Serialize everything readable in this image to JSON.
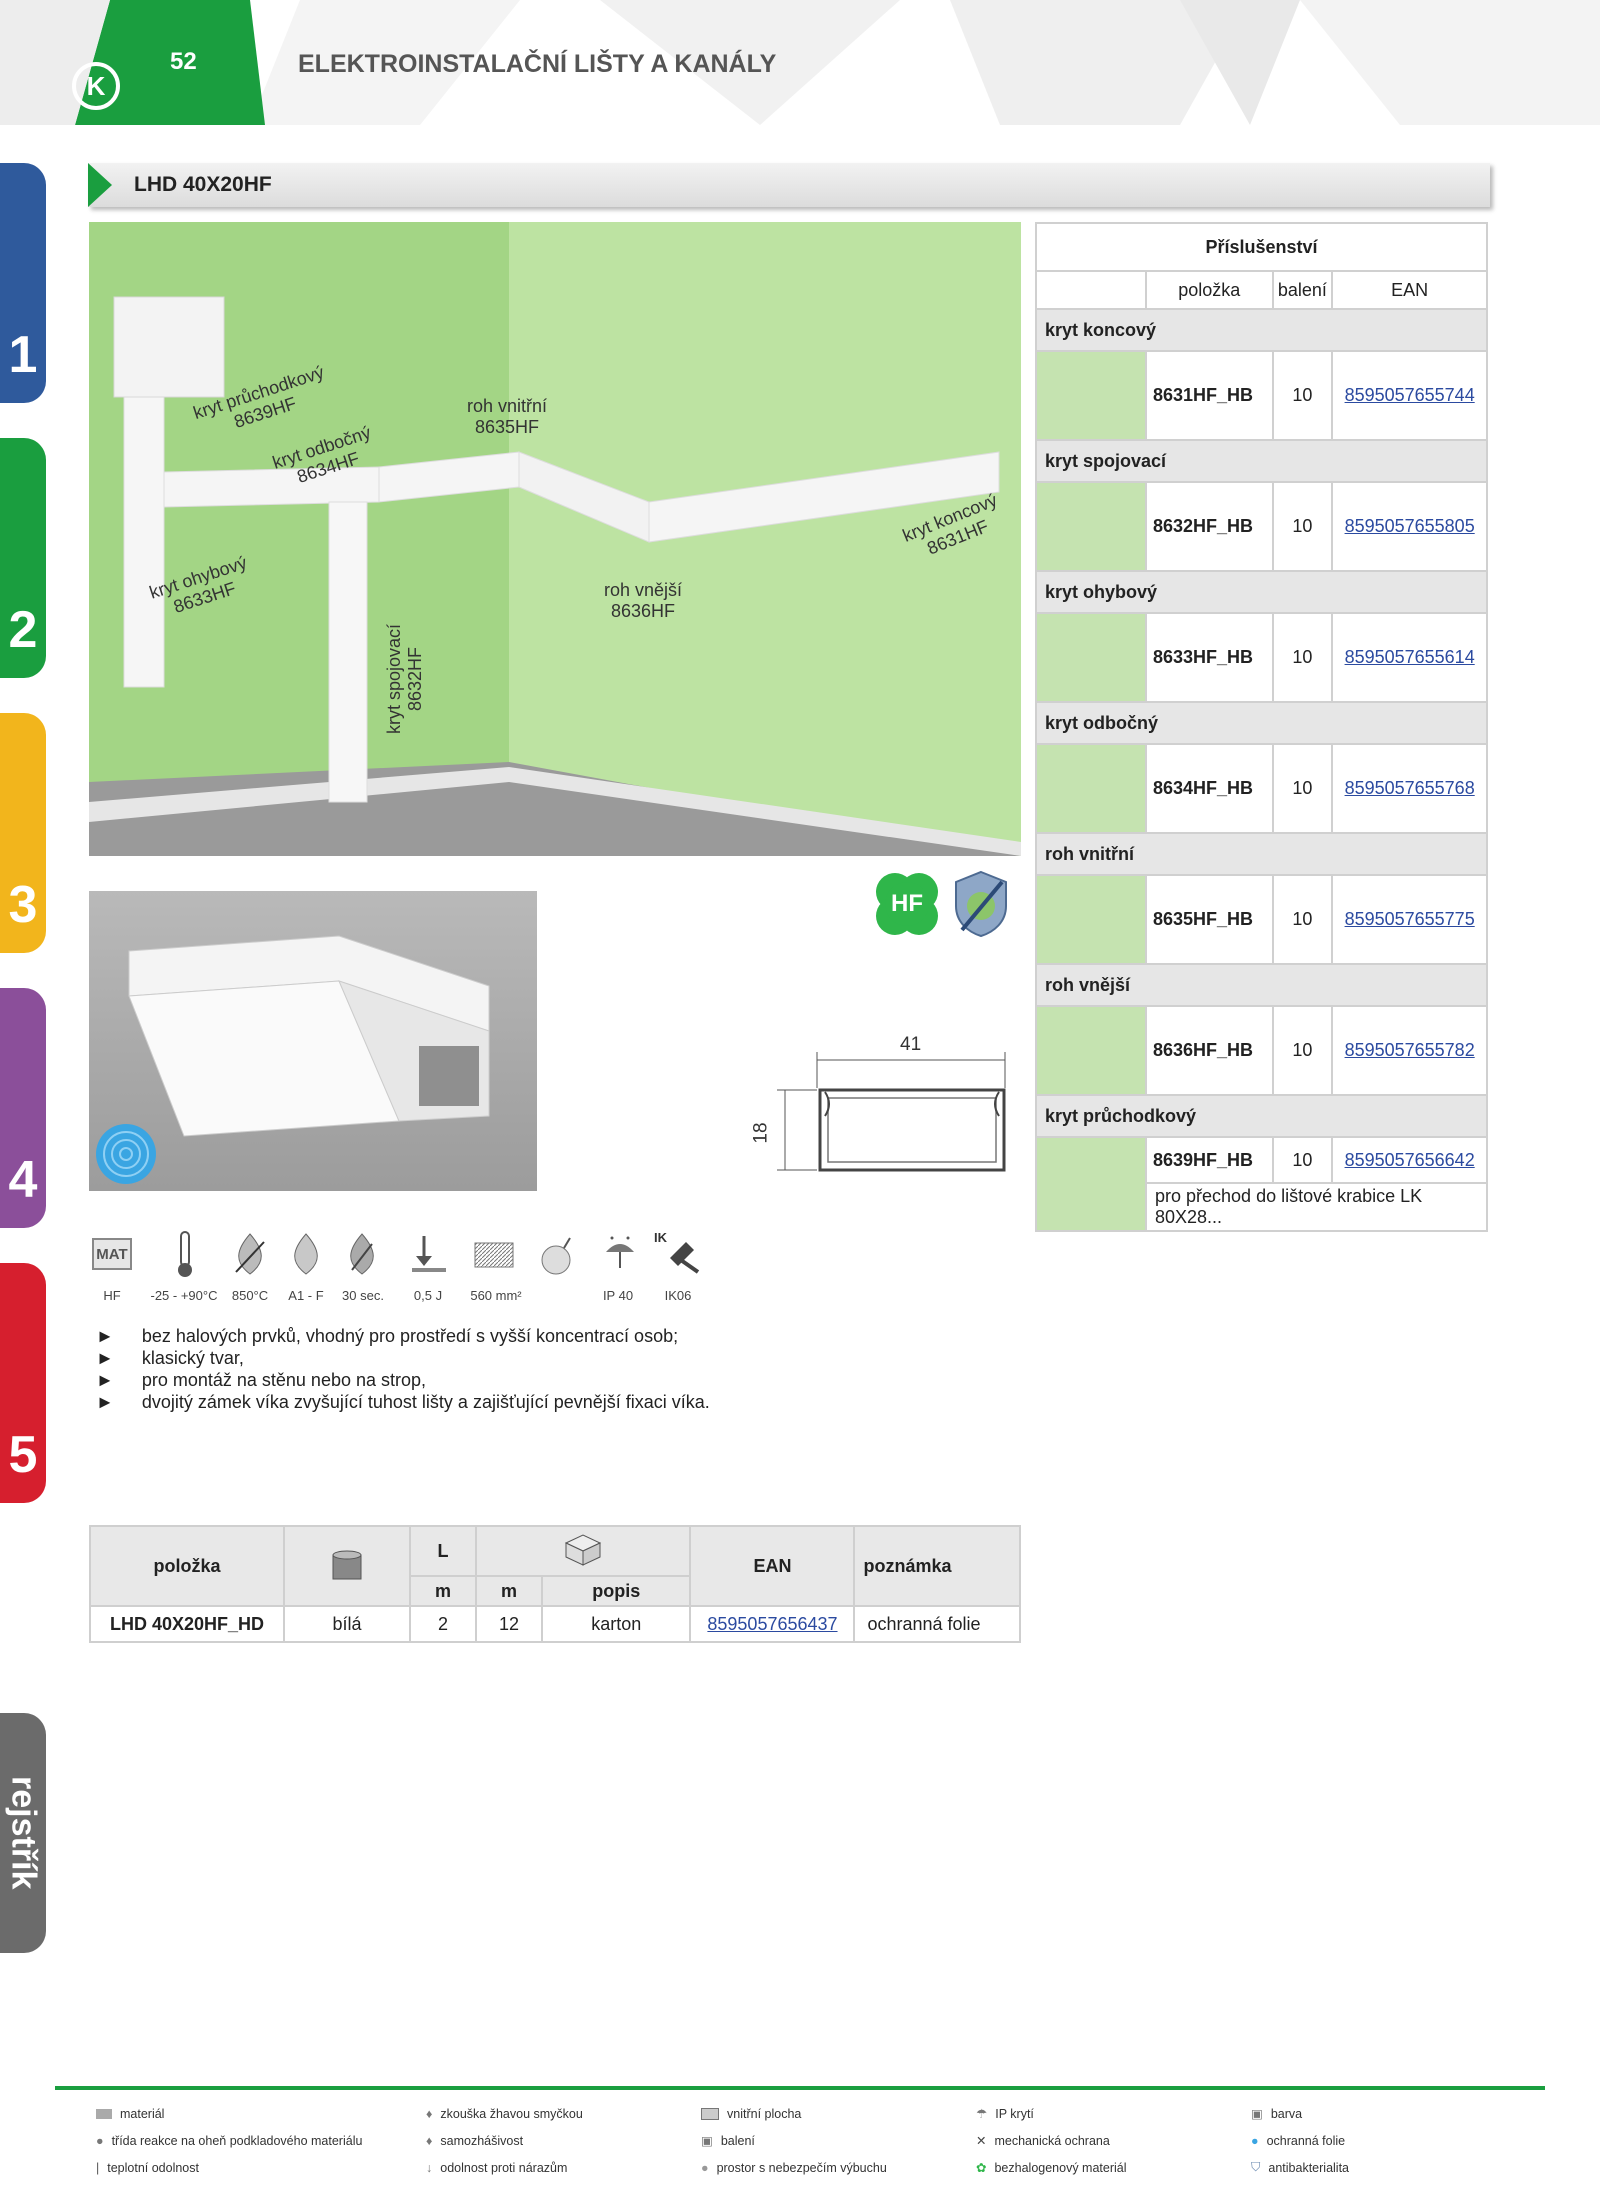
{
  "header": {
    "page_number": "52",
    "title": "ELEKTROINSTALAČNÍ LIŠTY A KANÁLY"
  },
  "side_tabs": [
    "1",
    "2",
    "3",
    "4",
    "5",
    "rejstřík"
  ],
  "product_title": "LHD 40X20HF",
  "photo_labels": [
    {
      "name": "kryt průchodkový",
      "code": "8639HF"
    },
    {
      "name": "kryt odbočný",
      "code": "8634HF"
    },
    {
      "name": "roh vnitřní",
      "code": "8635HF"
    },
    {
      "name": "kryt koncový",
      "code": "8631HF"
    },
    {
      "name": "kryt ohybový",
      "code": "8633HF"
    },
    {
      "name": "roh vnější",
      "code": "8636HF"
    },
    {
      "name": "kryt spojovací",
      "code": "8632HF"
    }
  ],
  "accessories": {
    "title": "Příslušenství",
    "columns": [
      "položka",
      "balení",
      "EAN"
    ],
    "items": [
      {
        "section": "kryt koncový",
        "code": "8631HF_HB",
        "pack": "10",
        "ean": "8595057655744"
      },
      {
        "section": "kryt spojovací",
        "code": "8632HF_HB",
        "pack": "10",
        "ean": "8595057655805"
      },
      {
        "section": "kryt ohybový",
        "code": "8633HF_HB",
        "pack": "10",
        "ean": "8595057655614"
      },
      {
        "section": "kryt odbočný",
        "code": "8634HF_HB",
        "pack": "10",
        "ean": "8595057655768"
      },
      {
        "section": "roh vnitřní",
        "code": "8635HF_HB",
        "pack": "10",
        "ean": "8595057655775"
      },
      {
        "section": "roh vnější",
        "code": "8636HF_HB",
        "pack": "10",
        "ean": "8595057655782"
      },
      {
        "section": "kryt průchodkový",
        "code": "8639HF_HB",
        "pack": "10",
        "ean": "8595057656642",
        "note": "pro přechod do lištové krabice LK 80X28..."
      }
    ]
  },
  "badges": [
    "HF"
  ],
  "dimensions": {
    "width": "41",
    "height": "18"
  },
  "properties": [
    "HF",
    "-25 - +90°C",
    "850°C",
    "A1 - F",
    "30 sec.",
    "0,5 J",
    "560 mm²",
    "IP 40",
    "IK06"
  ],
  "property_mat": "MAT",
  "property_ik": "IK",
  "bullets": [
    "bez halových prvků, vhodný pro prostředí s vyšší koncentrací osob;",
    "klasický tvar,",
    "pro montáž na stěnu nebo na strop,",
    "dvojitý zámek víka zvyšující tuhost lišty a zajišťující pevnější fixaci víka."
  ],
  "main_table": {
    "headers": {
      "item": "položka",
      "L": "L",
      "ean": "EAN",
      "note": "poznámka",
      "m1": "m",
      "m2": "m",
      "desc": "popis"
    },
    "row": {
      "item": "LHD 40X20HF_HD",
      "color": "bílá",
      "length": "2",
      "qty": "12",
      "package": "karton",
      "ean": "8595057656437",
      "note": "ochranná folie"
    }
  },
  "legend": [
    [
      "materiál",
      "třída reakce na oheň podkladového materiálu",
      "teplotní odolnost"
    ],
    [
      "zkouška žhavou smyčkou",
      "samozhášivost",
      "odolnost proti nárazům"
    ],
    [
      "vnitřní plocha",
      "balení",
      "prostor s nebezpečím výbuchu"
    ],
    [
      "IP krytí",
      "mechanická ochrana",
      "bezhalogenový materiál"
    ],
    [
      "barva",
      "ochranná folie",
      "antibakterialita"
    ]
  ],
  "colors": {
    "green": "#1a9e3f",
    "blue": "#2f5a9c",
    "yellow": "#f2b51c",
    "purple": "#8b4f9a",
    "red": "#d61f2e",
    "grey": "#6b6b6b",
    "wall": "#a9d98a"
  }
}
